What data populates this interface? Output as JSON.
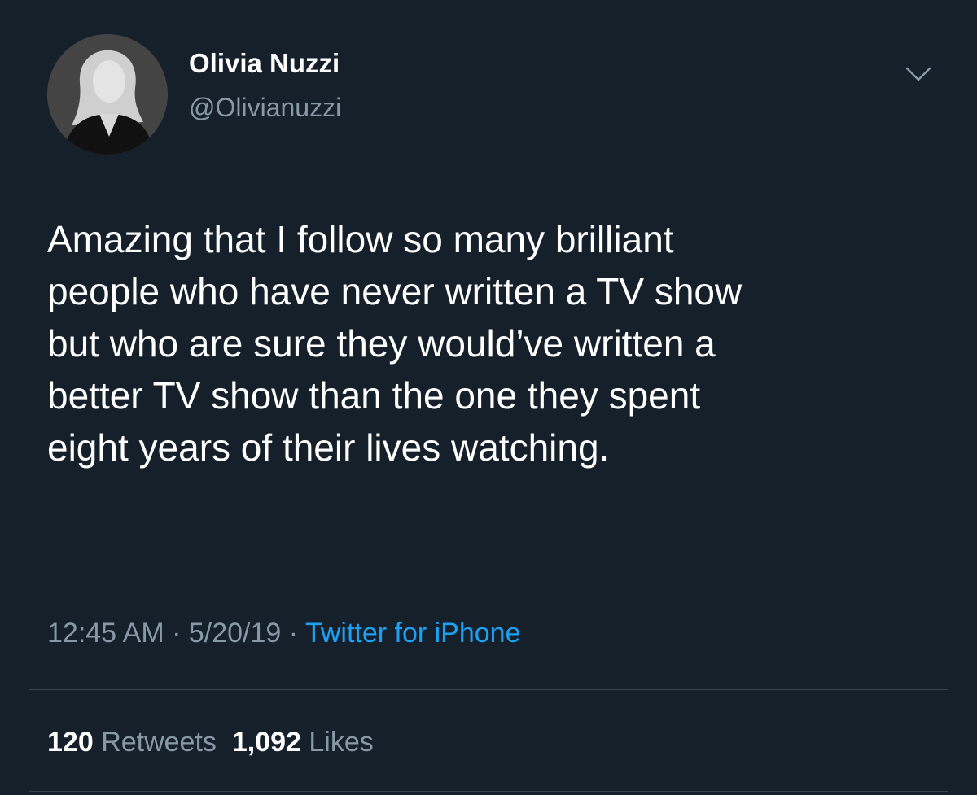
{
  "colors": {
    "background": "#15202b",
    "text_primary": "#ffffff",
    "text_secondary": "#8899a6",
    "accent": "#1da1f2",
    "divider": "#38444d"
  },
  "author": {
    "display_name": "Olivia Nuzzi",
    "handle": "@Olivianuzzi",
    "avatar_icon": "profile-photo"
  },
  "tweet": {
    "text": "Amazing that I follow so many brilliant\npeople who have never written a TV show\nbut who are sure they would’ve written a\nbetter TV show than the one they spent\neight years of their lives watching."
  },
  "meta": {
    "time": "12:45 AM",
    "separator": " · ",
    "date": "5/20/19",
    "source": "Twitter for iPhone"
  },
  "stats": {
    "retweets_count": "120",
    "retweets_label": "Retweets",
    "likes_count": "1,092",
    "likes_label": "Likes"
  },
  "icons": {
    "menu": "chevron-down-icon"
  }
}
